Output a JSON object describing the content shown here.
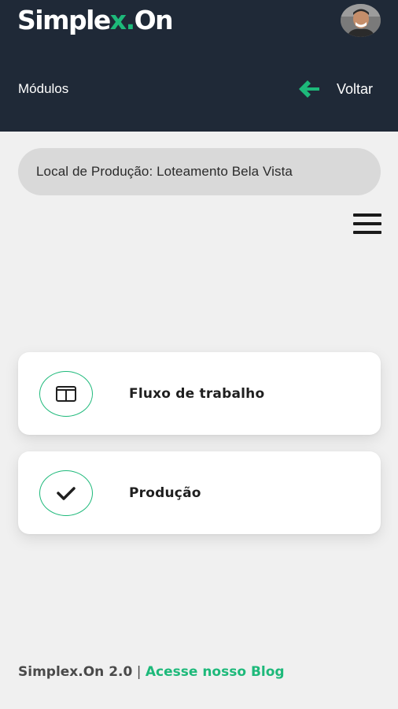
{
  "header": {
    "brand": {
      "part1": "Simple",
      "part2": "x",
      "part3": ".",
      "part4": "On"
    },
    "modules_label": "Módulos",
    "back_label": "Voltar"
  },
  "location": {
    "text": "Local de Produção: Loteamento Bela Vista"
  },
  "modules": [
    {
      "label": "Fluxo de trabalho",
      "icon": "columns-icon"
    },
    {
      "label": "Produção",
      "icon": "check-icon"
    }
  ],
  "footer": {
    "version": "Simplex.On 2.0",
    "separator": " | ",
    "blog_link": "Acesse nosso Blog"
  },
  "colors": {
    "header_bg": "#1f2937",
    "accent": "#1db97a",
    "page_bg": "#f0f0f0",
    "pill_bg": "#d9d9d9"
  }
}
